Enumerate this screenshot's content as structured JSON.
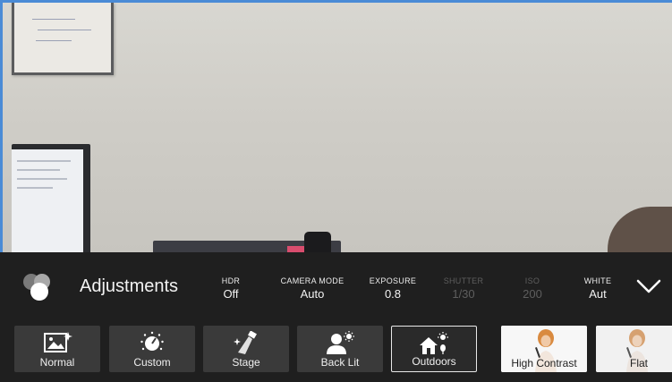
{
  "panel": {
    "title": "Adjustments",
    "settings": [
      {
        "label": "HDR",
        "value": "Off",
        "enabled": true
      },
      {
        "label": "CAMERA MODE",
        "value": "Auto",
        "enabled": true
      },
      {
        "label": "EXPOSURE",
        "value": "0.8",
        "enabled": true
      },
      {
        "label": "SHUTTER",
        "value": "1/30",
        "enabled": false
      },
      {
        "label": "ISO",
        "value": "200",
        "enabled": false
      },
      {
        "label": "WHITE",
        "value": "Aut",
        "enabled": true
      }
    ]
  },
  "presets": [
    {
      "label": "Normal",
      "icon": "image-sparkle-icon",
      "selected": false
    },
    {
      "label": "Custom",
      "icon": "dial-icon",
      "selected": false
    },
    {
      "label": "Stage",
      "icon": "spotlight-icon",
      "selected": false
    },
    {
      "label": "Back Lit",
      "icon": "person-sun-icon",
      "selected": false
    },
    {
      "label": "Outdoors",
      "icon": "house-sun-icon",
      "selected": true
    },
    {
      "label": "High Contrast",
      "icon": "singer-photo",
      "selected": false
    },
    {
      "label": "Flat",
      "icon": "singer-photo",
      "selected": false
    }
  ],
  "colors": {
    "panel_bg": "#1f1f1f",
    "tile_bg": "#3a3a3a",
    "border_accent": "#4a8bd6",
    "disabled_text": "#5e5e5e"
  }
}
